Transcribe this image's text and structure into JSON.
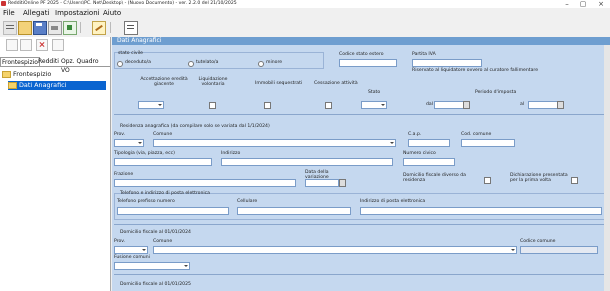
{
  "window": {
    "title": "RedditiOnline PF 2025 - C:\\Users\\PC. Net\\Desktop\\ - (Nuovo Documento) - ver. 2.2.0 del 21/10/2025"
  },
  "menu": [
    "File",
    "Allegati",
    "Impostazioni",
    "Aiuto"
  ],
  "nav": {
    "tabs": [
      "Frontespizio",
      "Redditi",
      "Opz. Quadro VO"
    ],
    "tree": {
      "root": "Frontespizio",
      "child": "Dati Anagrafici"
    }
  },
  "form": {
    "header": "Dati Anagrafici",
    "stato_civile": {
      "label": "stato civile",
      "options": [
        "deceduto/a",
        "tutelato/a",
        "minore"
      ]
    },
    "codice_stato_estero": "Codice stato estero",
    "partita_iva": "Partita IVA",
    "riservato": "Riservato al liquidatore ovvero al curatore fallimentare",
    "accettazione": "Accettazione eredità giacente",
    "liquidazione": "Liquidazione volontaria",
    "immobili": "Immobili sequestrati",
    "cessazione": "Cessazione attività",
    "stato": "Stato",
    "periodo": "Periodo d'imposta",
    "dal": "dal",
    "al": "al",
    "residenza_title": "Residenza anagrafica (da compilare solo se variata dal 1/1/2024)",
    "prov": "Prov.",
    "comune": "Comune",
    "cap": "C.a.p.",
    "cod_comune": "Cod. comune",
    "tipologia": "Tipologia (via, piazza, ecc)",
    "indirizzo": "Indirizzo",
    "numero_civico": "Numero civico",
    "frazione": "Frazione",
    "data_variazione": "Data della variazione",
    "domicilio_diverso": "Domicilio fiscale diverso da residenza",
    "dichiarazione_prima": "Dichiarazione presentata per la prima volta",
    "contatti_title": "Telefono e indirizzo di posta elettronica",
    "telefono": "Telefono prefisso numero",
    "cellulare": "Cellulare",
    "email": "Indirizzo di posta elettronica",
    "domicilio_2024": "Domicilio fiscale al 01/01/2024",
    "codice_comune": "Codice comune",
    "fusione": "Fusione comuni",
    "domicilio_2025": "Domicilio fiscale al 01/01/2025"
  }
}
